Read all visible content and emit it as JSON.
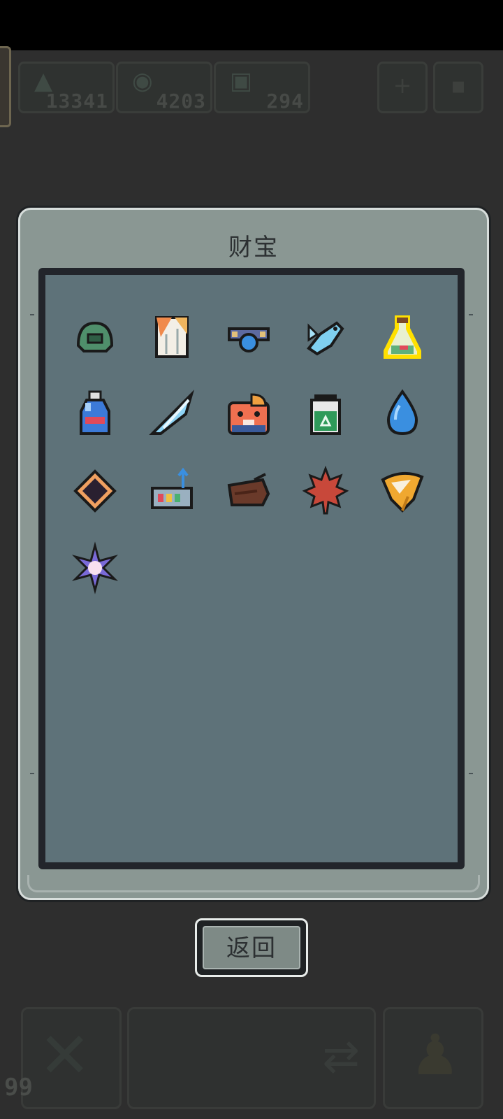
{
  "hud": {
    "resources": [
      {
        "icon": "triangle-icon",
        "value": "13341"
      },
      {
        "icon": "gem-icon",
        "value": "4203"
      },
      {
        "icon": "square-token-icon",
        "value": "294"
      }
    ],
    "bottom_count": "99"
  },
  "panel": {
    "title": "财宝",
    "items": [
      {
        "name": "green-helmet-icon"
      },
      {
        "name": "torn-scroll-icon"
      },
      {
        "name": "blue-orb-goggles-icon"
      },
      {
        "name": "blue-fish-icon"
      },
      {
        "name": "potion-flask-icon",
        "selected": true
      },
      {
        "name": "blue-bottle-icon"
      },
      {
        "name": "ice-blade-icon"
      },
      {
        "name": "orange-hamster-icon"
      },
      {
        "name": "green-trash-bin-icon"
      },
      {
        "name": "water-drop-icon"
      },
      {
        "name": "dark-diamond-icon"
      },
      {
        "name": "antenna-device-icon"
      },
      {
        "name": "wood-log-icon"
      },
      {
        "name": "red-maple-leaf-icon"
      },
      {
        "name": "golden-conch-icon"
      },
      {
        "name": "purple-sparkle-icon"
      }
    ]
  },
  "back_button": {
    "label": "返回"
  },
  "colors": {
    "selected_outline": "#ffe000",
    "panel_bg": "#8a9793",
    "grid_bg": "#5e7279"
  }
}
